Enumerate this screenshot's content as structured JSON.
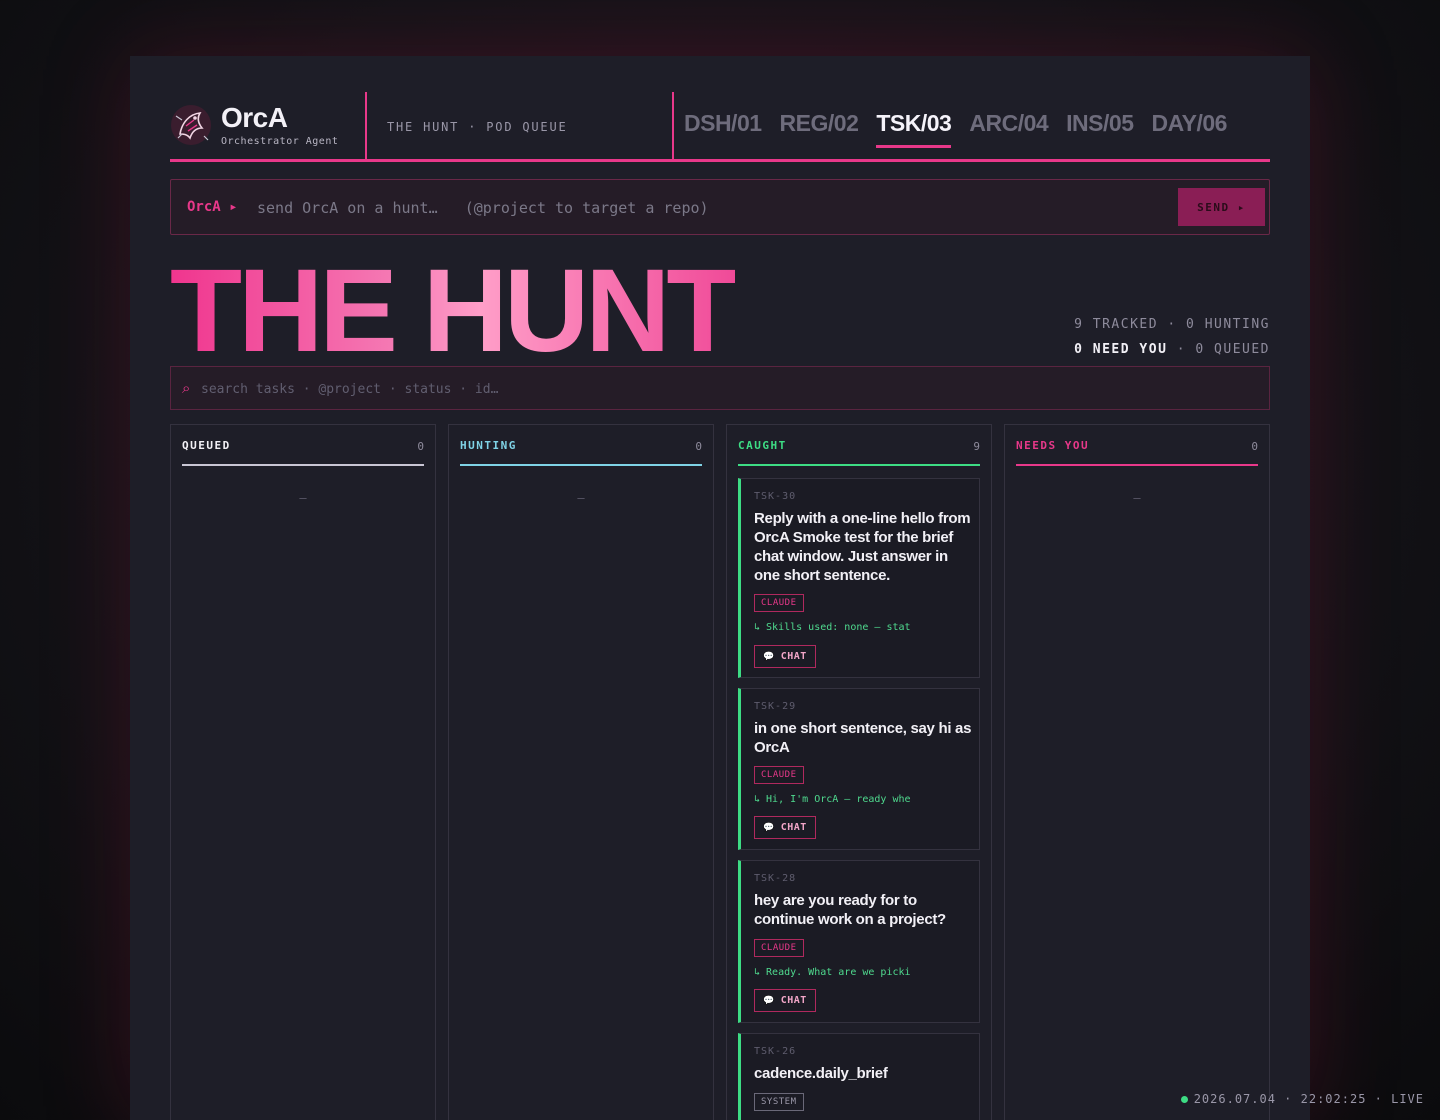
{
  "brand": {
    "name": "OrcA",
    "subtitle": "Orchestrator Agent"
  },
  "breadcrumb": "THE HUNT · POD QUEUE",
  "nav": {
    "tabs": [
      {
        "label": "DSH/01",
        "active": false
      },
      {
        "label": "REG/02",
        "active": false
      },
      {
        "label": "TSK/03",
        "active": true
      },
      {
        "label": "ARC/04",
        "active": false
      },
      {
        "label": "INS/05",
        "active": false
      },
      {
        "label": "DAY/06",
        "active": false
      }
    ]
  },
  "command": {
    "prompt": "OrcA ▸",
    "placeholder": "send OrcA on a hunt…   (@project to target a repo)",
    "send_label": "SEND ▸"
  },
  "hero": {
    "title": "THE HUNT"
  },
  "stats": {
    "line1": "9 TRACKED · 0 HUNTING",
    "need_you": "0 NEED YOU",
    "line2_rest": " · 0 QUEUED"
  },
  "search": {
    "icon": "⌕",
    "placeholder": "search tasks · @project · status · id…"
  },
  "columns": [
    {
      "title": "QUEUED",
      "count": "0",
      "color": "#c9c6d4",
      "empty": "–"
    },
    {
      "title": "HUNTING",
      "count": "0",
      "color": "#7fd3e6",
      "empty": "–"
    },
    {
      "title": "CAUGHT",
      "count": "9",
      "color": "#3ddc84"
    },
    {
      "title": "NEEDS YOU",
      "count": "0",
      "color": "#e8388a",
      "empty": "–"
    }
  ],
  "cards": [
    {
      "id": "TSK-30",
      "title": "Reply with a one-line hello from OrcA Smoke test for the brief chat window. Just answer in one short sentence.",
      "badge": "CLAUDE",
      "reply": "↳ Skills used: none — stat",
      "chat_label": "CHAT"
    },
    {
      "id": "TSK-29",
      "title": "in one short sentence, say hi as OrcA",
      "badge": "CLAUDE",
      "reply": "↳ Hi, I'm OrcA — ready whe",
      "chat_label": "CHAT"
    },
    {
      "id": "TSK-28",
      "title": "hey are you ready for to continue work on a project?",
      "badge": "CLAUDE",
      "reply": "↳ Ready. What are we picki",
      "chat_label": "CHAT"
    },
    {
      "id": "TSK-26",
      "title": "cadence.daily_brief",
      "badge": "SYSTEM"
    }
  ],
  "status": {
    "datetime": "2026.07.04 · 22:02:25 · LIVE"
  },
  "colors": {
    "accent": "#e8388a",
    "caught": "#3ddc84",
    "hunting": "#7fd3e6",
    "background": "#1e1e28"
  }
}
